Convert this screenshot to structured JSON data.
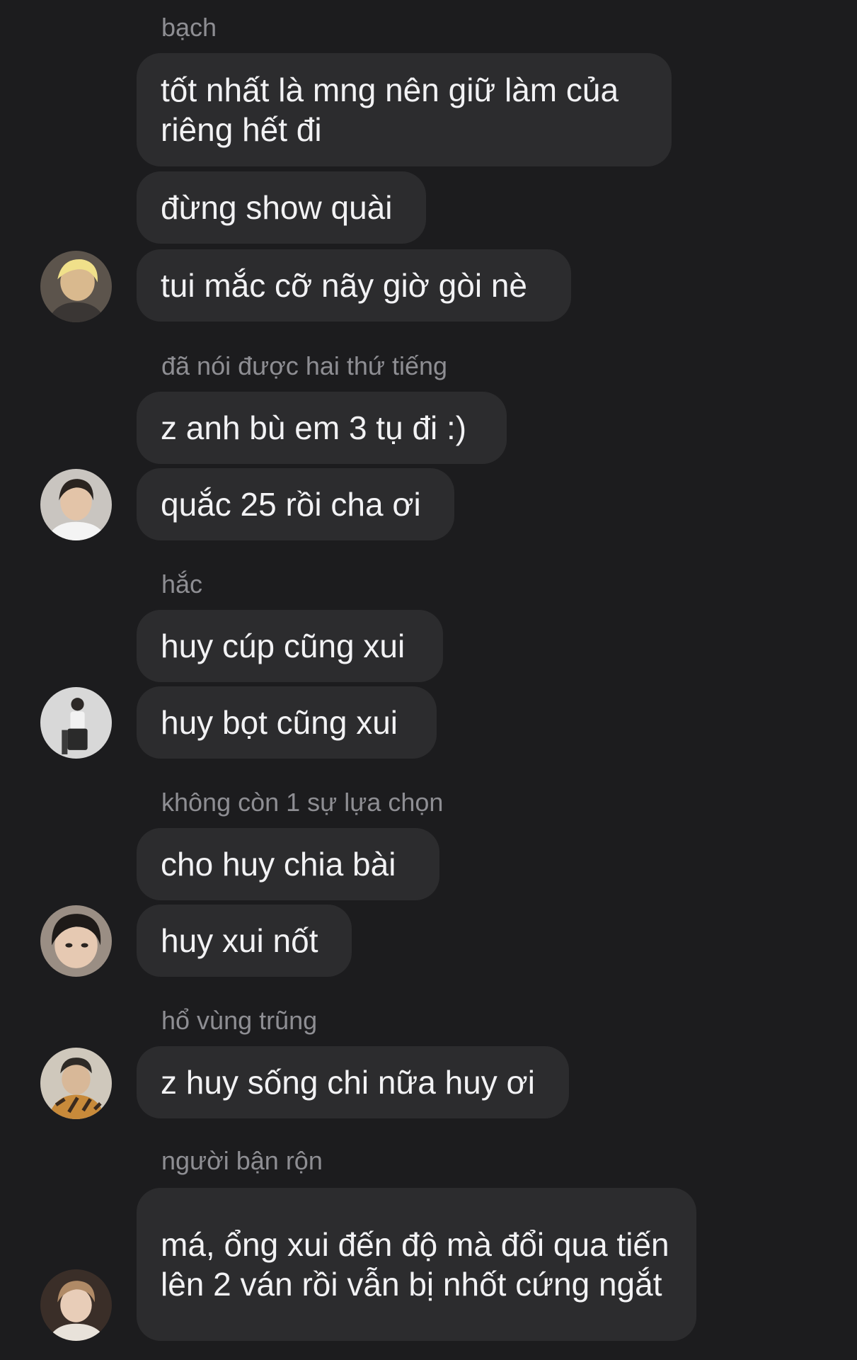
{
  "groups": [
    {
      "sender": "bạch",
      "messages": [
        "tốt nhất là mng nên giữ làm của riêng hết đi",
        "đừng show quài",
        "tui mắc cỡ nãy giờ gòi nè"
      ],
      "avatar_icon": "user-avatar-blonde-icon"
    },
    {
      "sender": "đã nói được hai thứ tiếng",
      "messages": [
        "z anh bù em 3 tụ đi :)",
        "quắc 25 rồi cha ơi"
      ],
      "avatar_icon": "user-avatar-icon"
    },
    {
      "sender": "hắc",
      "messages": [
        "huy cúp cũng xui",
        "huy bọt cũng xui"
      ],
      "avatar_icon": "user-avatar-icon"
    },
    {
      "sender": "không còn 1 sự lựa chọn",
      "messages": [
        "cho huy chia bài",
        "huy xui nốt"
      ],
      "avatar_icon": "user-avatar-icon"
    },
    {
      "sender": "hổ vùng trũng",
      "messages": [
        "z huy sống chi nữa huy ơi"
      ],
      "avatar_icon": "user-avatar-icon"
    },
    {
      "sender": "người bận rộn",
      "messages": [
        "má, ổng xui đến độ mà đổi qua tiến lên 2 ván rồi vẫn bị nhốt cứng ngắt"
      ],
      "avatar_icon": "user-avatar-icon"
    }
  ],
  "colors": {
    "background": "#1c1c1e",
    "bubble": "#2c2c2e",
    "sender_name": "#8e8e93",
    "text": "#f2f2f4"
  }
}
